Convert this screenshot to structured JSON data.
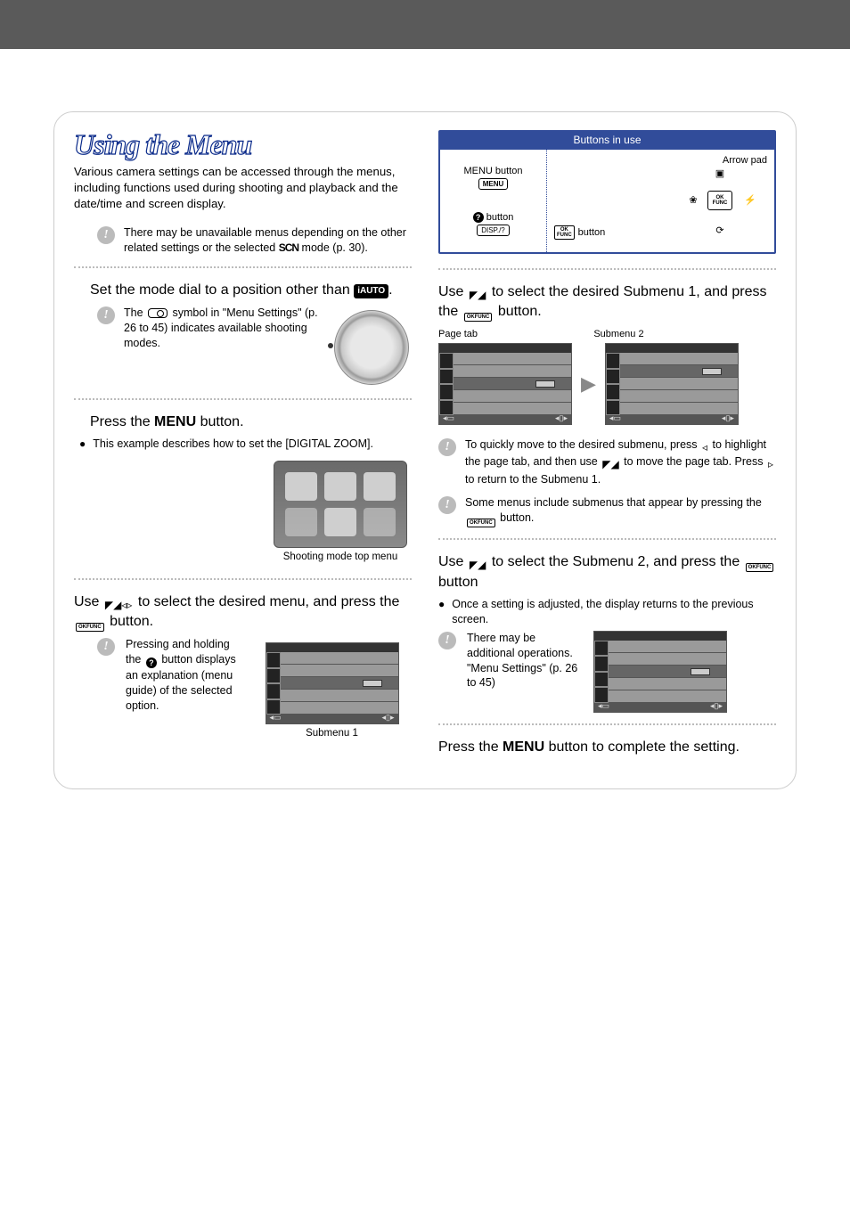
{
  "title": "Using the Menu",
  "intro": "Various camera settings can be accessed through the menus, including functions used during shooting and playback and the date/time and screen display.",
  "note_scn": {
    "before": "There may be unavailable menus depending on the other related settings or the selected ",
    "scn": "SCN",
    "after": " mode (p. 30)."
  },
  "step1": {
    "title_before": "Set the mode dial to a position other than ",
    "iauto": "iAUTO",
    "title_after": ".",
    "note": "The  symbol in \"Menu Settings\" (p. 26 to 45) indicates available shooting modes.",
    "note_before": "The ",
    "note_after": " symbol in \"Menu Settings\" (p. 26 to 45) indicates available shooting modes."
  },
  "step2": {
    "title_before": "Press the ",
    "menu_word": "MENU",
    "title_after": " button.",
    "bullet": "This example describes how to set the [DIGITAL ZOOM].",
    "caption": "Shooting mode top menu"
  },
  "step3": {
    "title_before": "Use ",
    "title_mid": " to select the desired menu, and press the ",
    "title_after": " button.",
    "note_before": "Pressing and holding the ",
    "note_after": " button displays an explanation (menu guide) of the selected option.",
    "caption": "Submenu 1"
  },
  "btn_panel": {
    "header": "Buttons in use",
    "menu_label_before": "MENU",
    "menu_label_after": " button",
    "q_label": " button",
    "arrow_label": "Arrow pad",
    "ok_label": " button",
    "menu_icon": "MENU",
    "disp_icon": "DISP./?",
    "ok_top": "OK",
    "ok_bot": "FUNC"
  },
  "step4": {
    "title_before": "Use ",
    "title_mid": " to select the desired Submenu 1, and press the ",
    "title_after": " button.",
    "label_left": "Page tab",
    "label_right": "Submenu 2",
    "note1_a": "To quickly move to the desired submenu, press ",
    "note1_b": " to highlight the page tab, and then use ",
    "note1_c": " to move the page tab. Press ",
    "note1_d": " to return to the Submenu 1.",
    "note2_a": "Some menus include submenus that appear by pressing the ",
    "note2_b": " button."
  },
  "step5": {
    "title_before": "Use ",
    "title_mid": " to select the Submenu 2, and press the ",
    "title_after": " button",
    "bullet": "Once a setting is adjusted, the display returns to the previous screen.",
    "note": "There may be additional operations. \"Menu Settings\" (p. 26 to 45)"
  },
  "step6": {
    "before": "Press the ",
    "menu_word": "MENU",
    "after": " button to complete the setting."
  }
}
